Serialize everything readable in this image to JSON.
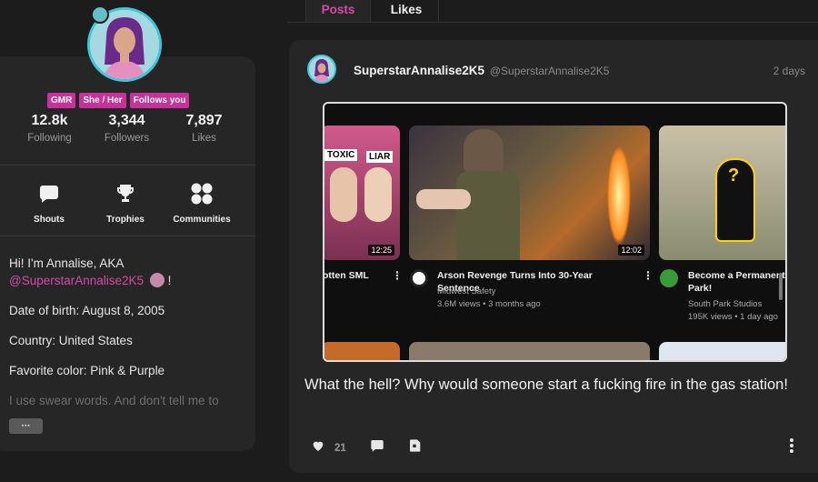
{
  "tabs": {
    "posts": "Posts",
    "likes": "Likes"
  },
  "profile": {
    "badges": [
      "GMR",
      "She / Her",
      "Follows you"
    ],
    "stats": [
      {
        "value": "12.8k",
        "label": "Following"
      },
      {
        "value": "3,344",
        "label": "Followers"
      },
      {
        "value": "7,897",
        "label": "Likes"
      }
    ],
    "tiles": [
      {
        "label": "Shouts",
        "icon": "chat-bubble-icon"
      },
      {
        "label": "Trophies",
        "icon": "trophy-icon"
      },
      {
        "label": "Communities",
        "icon": "communities-icon"
      }
    ],
    "bio": {
      "intro": "Hi! I'm Annalise, AKA",
      "handle": "@SuperstarAnnalise2K5",
      "exclaim": "!",
      "dob": "Date of birth: August 8, 2005",
      "country": "Country: United States",
      "color": "Favorite color: Pink & Purple",
      "swear": "I use swear words. And don't tell me to"
    },
    "more_label": "···"
  },
  "post": {
    "username": "SuperstarAnnalise2K5",
    "handle": "@SuperstarAnnalise2K5",
    "time": "2 days",
    "text": "What the hell? Why would someone start a fucking fire in the gas station!",
    "likes": "21",
    "embed": {
      "videos": [
        {
          "title": "otten SML",
          "duration": "12:25",
          "channel": "",
          "stats": "",
          "thumb_labels": [
            "TOXIC",
            "LIAR"
          ]
        },
        {
          "title": "Arson Revenge Turns Into 30-Year Sentence",
          "duration": "12:02",
          "channel": "Midwest Safety",
          "stats": "3.6M views • 3 months ago"
        },
        {
          "title": "Become a Permanent Park!",
          "duration": "",
          "channel": "South Park Studios",
          "stats": "195K views • 1 day ago"
        }
      ]
    }
  },
  "colors": {
    "accent": "#d64aa8",
    "badge": "#c8319a",
    "avatar_ring": "#3ec7d9"
  }
}
